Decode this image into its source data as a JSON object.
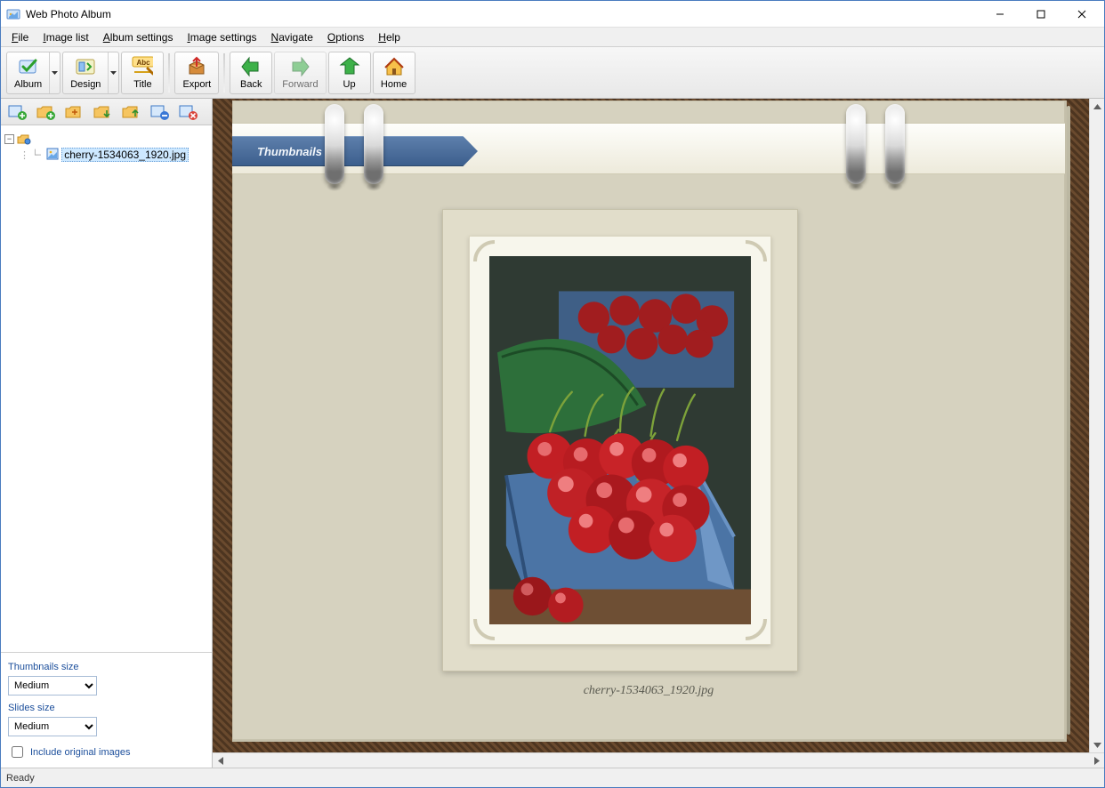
{
  "window": {
    "title": "Web Photo Album"
  },
  "menu": {
    "file": "File",
    "image_list": "Image list",
    "album_settings": "Album settings",
    "image_settings": "Image settings",
    "navigate": "Navigate",
    "options": "Options",
    "help": "Help"
  },
  "toolbar": {
    "album": "Album",
    "design": "Design",
    "title": "Title",
    "export": "Export",
    "back": "Back",
    "forward": "Forward",
    "up": "Up",
    "home": "Home"
  },
  "tree": {
    "root_icon_name": "album-root-icon",
    "items": [
      {
        "label": "cherry-1534063_1920.jpg",
        "selected": true
      }
    ]
  },
  "left_panel": {
    "thumbs_label": "Thumbnails size",
    "thumbs_value": "Medium",
    "slides_label": "Slides size",
    "slides_value": "Medium",
    "include_original": "Include original images",
    "include_original_checked": false
  },
  "preview": {
    "ribbon_label": "Thumbnails",
    "caption": "cherry-1534063_1920.jpg"
  },
  "status": {
    "text": "Ready"
  }
}
